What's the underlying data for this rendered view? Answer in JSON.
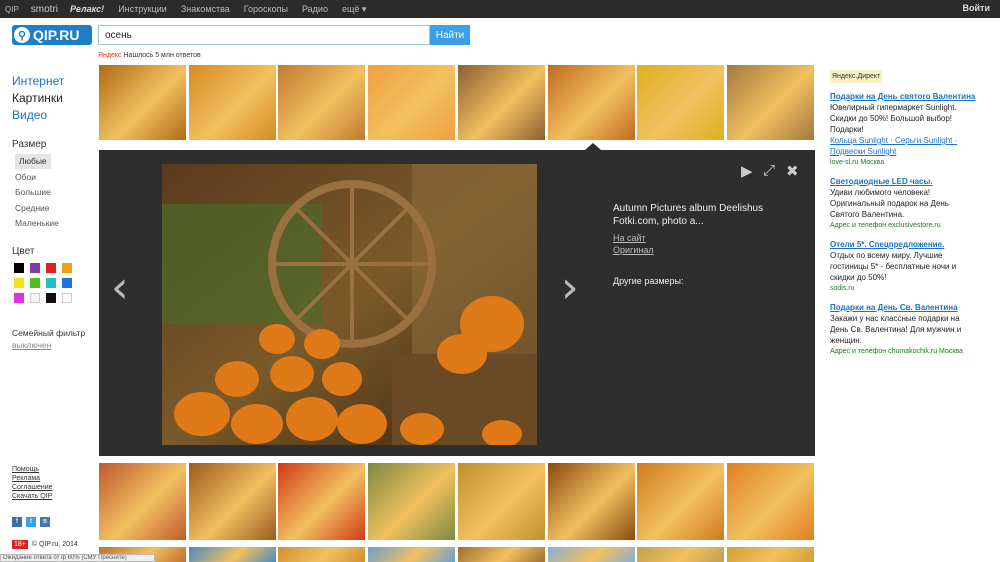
{
  "topbar": {
    "brand": "QIP",
    "items": [
      "smotri",
      "Релакс!",
      "Инструкции",
      "Знакомства",
      "Гороскопы",
      "Радио",
      "ещё ▾"
    ],
    "login": "Войти"
  },
  "logo": {
    "text": "QIP.RU",
    "icon": "search-magnifier-icon"
  },
  "search": {
    "value": "осень",
    "button": "Найти"
  },
  "found": {
    "prefix": "Яндекс",
    "text": "Нашлось 5 млн ответов"
  },
  "nav": {
    "items": [
      "Интернет",
      "Картинки",
      "Видео"
    ]
  },
  "filters": {
    "size_title": "Размер",
    "sizes": [
      "Любые",
      "Обои",
      "Большие",
      "Средние",
      "Маленькие"
    ],
    "color_title": "Цвет",
    "colors": [
      "#000000",
      "#7a3fa8",
      "#e02020",
      "#f0a010",
      "#f5e020",
      "#50c020",
      "#20c0c0",
      "#2070e0",
      "#e030e0",
      "#f4f4f4",
      "#101010",
      "#ffffff"
    ],
    "family_title": "Семейный фильтр",
    "family_value": "выключен"
  },
  "footer": {
    "links": [
      "Помощь",
      "Реклама",
      "Соглашение",
      "Скачать QIP"
    ],
    "social": [
      "f",
      "t",
      "в"
    ],
    "age": "18+",
    "copyright": "© QIP.ru, 2014"
  },
  "viewer": {
    "title": "Autumn Pictures album Deelishus Fotki.com, photo a...",
    "site_link": "На сайт",
    "original_link": "Оригинал",
    "other_sizes": "Другие размеры:",
    "prev": "‹",
    "next": "›",
    "controls": {
      "play": "▶",
      "expand": "⤢",
      "close": "✖"
    }
  },
  "thumbs": {
    "row1": [
      "#b06a18",
      "#d88a20",
      "#c27a30",
      "#f0a040",
      "#8a6030",
      "#c06a20",
      "#e0b020",
      "#a07a40"
    ],
    "row2": [
      "#c05a30",
      "#9a5a20",
      "#d03a18",
      "#7a8a40",
      "#c09030",
      "#8a4a10",
      "#d07a20",
      "#e08020"
    ],
    "row3": [
      "#c07030",
      "#4a8ac0",
      "#d09030",
      "#6aa0d0",
      "#a07030",
      "#8ab0d0",
      "#c0a050",
      "#d0a030"
    ]
  },
  "ads": {
    "header": "Яндекс.Директ",
    "items": [
      {
        "title": "Подарки на День святого Валентина",
        "body": "Ювелирный гипермаркет Sunlight. Скидки до 50%! Большой выбор! Подарки!",
        "links": "Кольца Sunlight · Серьги Sunlight · Подвески Sunlight",
        "url": "love-sl.ru Москва"
      },
      {
        "title": "Светодиодные LED часы.",
        "body": "Удиви любимого человека! Оригинальный подарок на День Святого Валентина.",
        "links": "",
        "url": "Адрес и телефон  exclusivestore.ru"
      },
      {
        "title": "Отели 5*. Спецпредложение.",
        "body": "Отдых по всему миру. Лучшие гостиницы 5* - бесплатные ночи и скидки до 50%!",
        "links": "",
        "url": "sodis.ru"
      },
      {
        "title": "Подарки на День Св. Валентина",
        "body": "Закажи у нас классные подарки на День Св. Валентина! Для мужчин и женщин.",
        "links": "",
        "url": "Адрес и телефон  chumakochik.ru Москва"
      }
    ]
  },
  "statusbar": "Ожидание ответа от ф 60% (СМУ Пресните)"
}
